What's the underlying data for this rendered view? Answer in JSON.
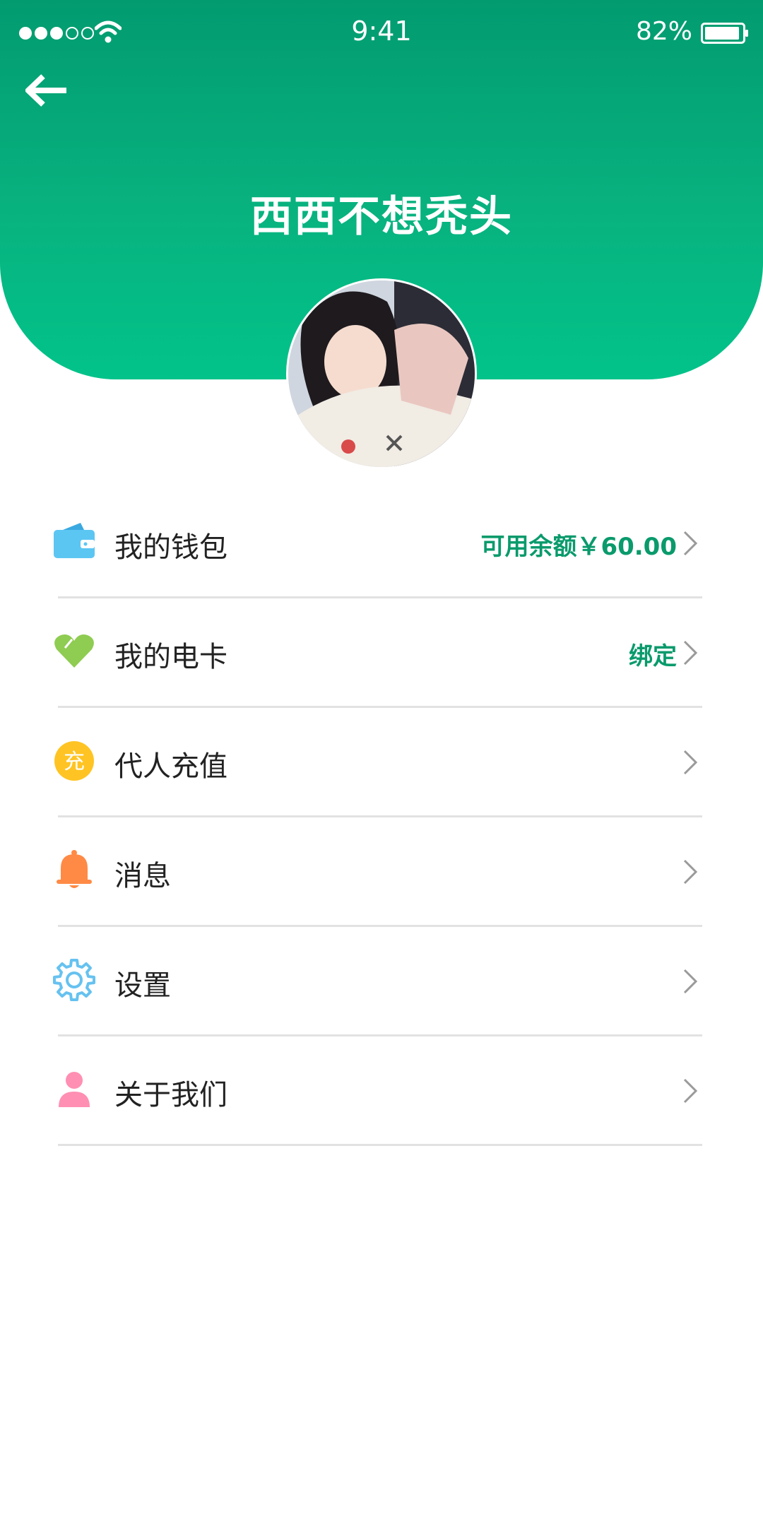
{
  "status_bar": {
    "time": "9:41",
    "battery": "82%"
  },
  "header": {
    "title": "西西不想秃头"
  },
  "menu": {
    "wallet": {
      "label": "我的钱包",
      "value": "可用余额￥60.00"
    },
    "ecard": {
      "label": "我的电卡",
      "value": "绑定"
    },
    "recharge": {
      "label": "代人充值",
      "icon_text": "充"
    },
    "messages": {
      "label": "消息"
    },
    "settings": {
      "label": "设置"
    },
    "about": {
      "label": "关于我们"
    }
  },
  "colors": {
    "header_top": "#029b70",
    "header_bottom": "#02c38a",
    "accent_text": "#0a9a6c",
    "wallet_icon": "#5cc6f3",
    "ecard_icon": "#8fcc52",
    "recharge_icon": "#ffc423",
    "bell_icon": "#ff8a45",
    "gear_icon": "#66c2f0",
    "person_icon": "#ff8fb3"
  },
  "icons": [
    "back-arrow-icon",
    "wallet-icon",
    "heart-card-icon",
    "recharge-icon",
    "bell-icon",
    "gear-icon",
    "person-icon",
    "chevron-right-icon"
  ]
}
